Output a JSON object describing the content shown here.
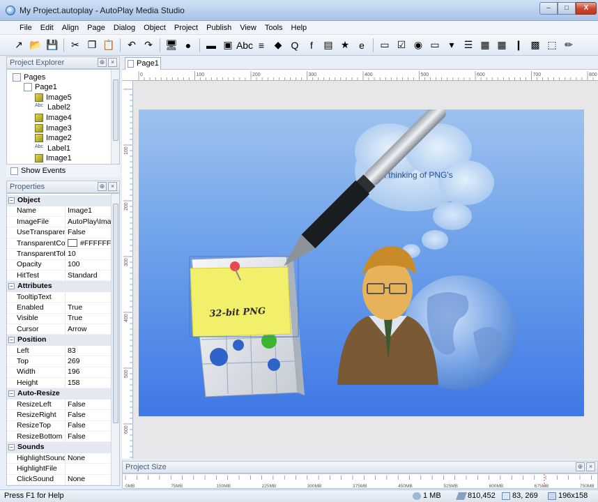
{
  "window": {
    "title": "My Project.autoplay - AutoPlay Media Studio",
    "min_label": "–",
    "max_label": "□",
    "close_label": "X"
  },
  "menu": [
    "File",
    "Edit",
    "Align",
    "Page",
    "Dialog",
    "Object",
    "Project",
    "Publish",
    "View",
    "Tools",
    "Help"
  ],
  "toolbar": {
    "icons": [
      "wand-icon",
      "open-icon",
      "save-icon",
      "cut-icon",
      "copy-icon",
      "paste-icon",
      "undo-icon",
      "redo-icon",
      "preview-icon",
      "build-icon",
      "button-object-icon",
      "image-object-icon",
      "label-object-icon",
      "paragraph-object-icon",
      "3d-object-icon",
      "web-object-icon",
      "flash-object-icon",
      "slideshow-object-icon",
      "pdf-object-icon",
      "ie-object-icon",
      "input-object-icon",
      "checkbox-object-icon",
      "radio-object-icon",
      "progress-object-icon",
      "combobox-object-icon",
      "listbox-object-icon",
      "tree-object-icon",
      "grid-object-icon",
      "bar-object-icon",
      "xbutton-object-icon",
      "select-object-icon",
      "pen-icon"
    ],
    "glyphs": [
      "↗",
      "📂",
      "💾",
      "✂",
      "❐",
      "📋",
      "↶",
      "↷",
      "🖥",
      "●",
      "▬",
      "▣",
      "Abc",
      "≡",
      "◆",
      "Q",
      "f",
      "▤",
      "★",
      "e",
      "▭",
      "☑",
      "◉",
      "▭",
      "▾",
      "☰",
      "▦",
      "▦",
      "❙",
      "▩",
      "⬚",
      "✏"
    ]
  },
  "explorer": {
    "title": "Project Explorer",
    "items": [
      {
        "label": "Pages",
        "type": "folder",
        "indent": 0
      },
      {
        "label": "Page1",
        "type": "page",
        "indent": 1
      },
      {
        "label": "Image5",
        "type": "image",
        "indent": 2
      },
      {
        "label": "Label2",
        "type": "label",
        "indent": 2
      },
      {
        "label": "Image4",
        "type": "image",
        "indent": 2
      },
      {
        "label": "Image3",
        "type": "image",
        "indent": 2
      },
      {
        "label": "Image2",
        "type": "image",
        "indent": 2
      },
      {
        "label": "Label1",
        "type": "label",
        "indent": 2
      },
      {
        "label": "Image1",
        "type": "image",
        "indent": 2
      }
    ],
    "show_events_label": "Show Events",
    "label_icon_text": "Abc"
  },
  "properties": {
    "title": "Properties",
    "rows": [
      {
        "cat": "Object"
      },
      {
        "k": "Name",
        "v": "Image1"
      },
      {
        "k": "ImageFile",
        "v": "AutoPlay\\Imag"
      },
      {
        "k": "UseTransparent",
        "v": "False"
      },
      {
        "k": "TransparentCol",
        "v": "#FFFFFF",
        "swatch": "#FFFFFF"
      },
      {
        "k": "TransparentTol",
        "v": "10"
      },
      {
        "k": "Opacity",
        "v": "100"
      },
      {
        "k": "HitTest",
        "v": "Standard"
      },
      {
        "cat": "Attributes"
      },
      {
        "k": "TooltipText",
        "v": ""
      },
      {
        "k": "Enabled",
        "v": "True"
      },
      {
        "k": "Visible",
        "v": "True"
      },
      {
        "k": "Cursor",
        "v": "Arrow"
      },
      {
        "cat": "Position"
      },
      {
        "k": "Left",
        "v": "83"
      },
      {
        "k": "Top",
        "v": "269"
      },
      {
        "k": "Width",
        "v": "196"
      },
      {
        "k": "Height",
        "v": "158"
      },
      {
        "cat": "Auto-Resize"
      },
      {
        "k": "ResizeLeft",
        "v": "False"
      },
      {
        "k": "ResizeRight",
        "v": "False"
      },
      {
        "k": "ResizeTop",
        "v": "False"
      },
      {
        "k": "ResizeBottom",
        "v": "False"
      },
      {
        "cat": "Sounds"
      },
      {
        "k": "HighlightSounc",
        "v": "None"
      },
      {
        "k": "HighlightFile",
        "v": ""
      },
      {
        "k": "ClickSound",
        "v": "None"
      }
    ]
  },
  "document": {
    "tab": "Page1",
    "ruler_top_labels": [
      "0",
      "100",
      "200",
      "300",
      "400",
      "500",
      "600",
      "700",
      "800"
    ],
    "ruler_left_labels": [
      "100",
      "200",
      "300",
      "400",
      "500",
      "600"
    ],
    "thought_text": "I'm thinking of PNG's",
    "note_text": "32-bit PNG"
  },
  "project_size": {
    "title": "Project Size",
    "labels": [
      "0MB",
      "75MB",
      "150MB",
      "225MB",
      "300MB",
      "375MB",
      "450MB",
      "525MB",
      "600MB",
      "675MB",
      "750MB"
    ]
  },
  "status": {
    "help": "Press F1 for Help",
    "size": "1 MB",
    "mouse": "810,452",
    "position": "83, 269",
    "dimensions": "196x158"
  },
  "colors": {
    "stage_top": "#9dc2ef",
    "stage_bottom": "#3f78e6",
    "note": "#f2ef6a"
  }
}
